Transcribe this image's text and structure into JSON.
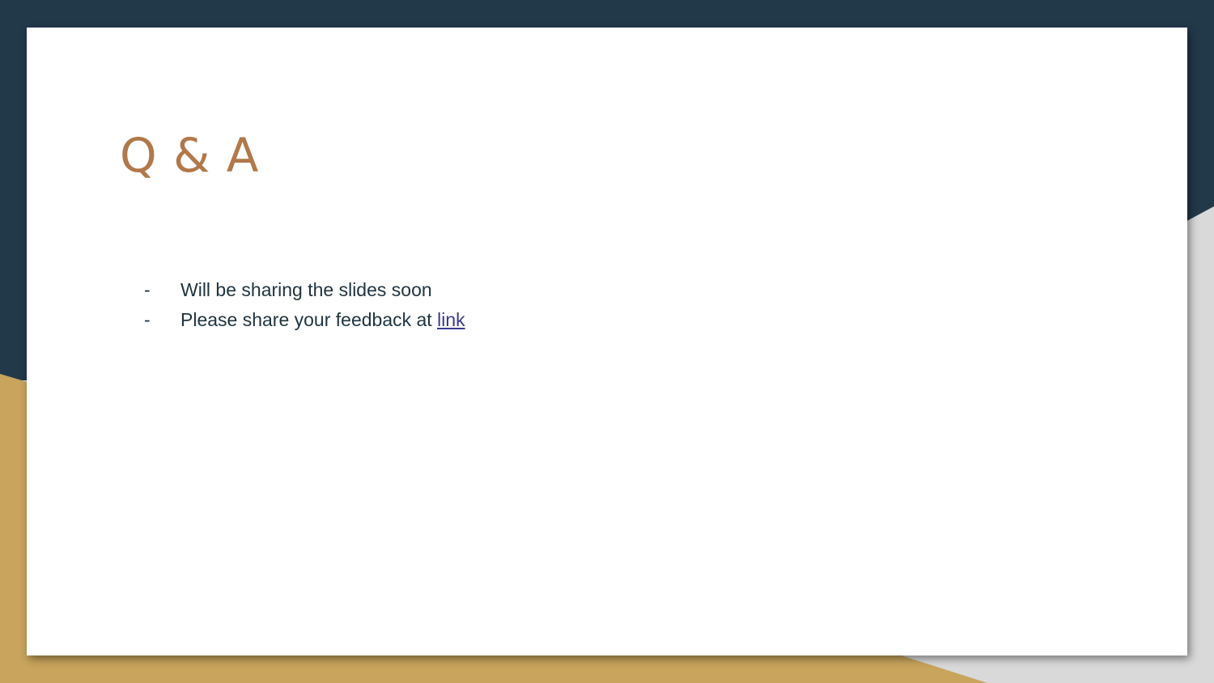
{
  "slide": {
    "title": "Q & A",
    "bullets": [
      {
        "marker": "-",
        "text": "Will be sharing the slides soon"
      },
      {
        "marker": "-",
        "text": "Please share your feedback at ",
        "link_label": "link"
      }
    ]
  },
  "colors": {
    "navy": "#22394a",
    "gold": "#c8a45c",
    "gray": "#d9d9d9",
    "title": "#b1784a",
    "body_text": "#1f3340",
    "link": "#3c3a8f"
  }
}
